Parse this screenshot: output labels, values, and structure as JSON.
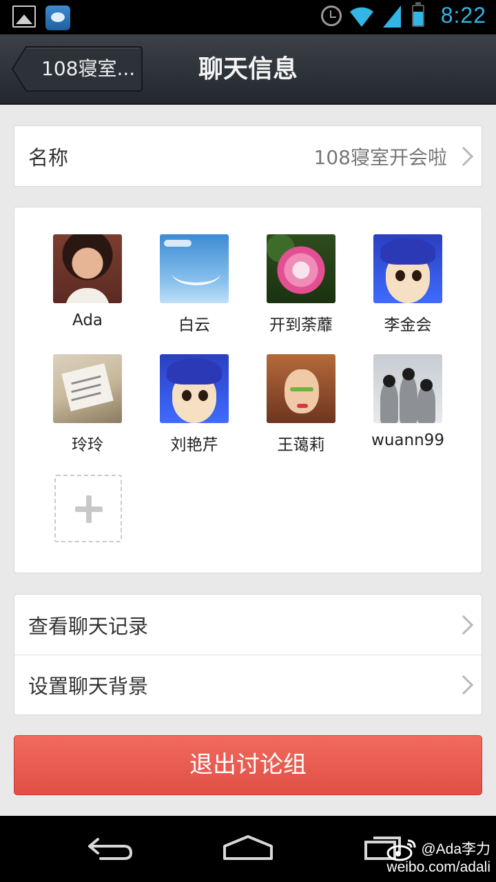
{
  "status_bar": {
    "time": "8:22",
    "accent_color": "#33b5e5"
  },
  "title_bar": {
    "back_label": "108寝室...",
    "title": "聊天信息"
  },
  "name_row": {
    "label": "名称",
    "value": "108寝室开会啦"
  },
  "members": [
    {
      "name": "Ada",
      "avatar": "photo-woman"
    },
    {
      "name": "白云",
      "avatar": "sky-cloud"
    },
    {
      "name": "开到荼蘼",
      "avatar": "pink-rose"
    },
    {
      "name": "李金会",
      "avatar": "anime-girl-blue-hair"
    },
    {
      "name": "玲玲",
      "avatar": "open-book"
    },
    {
      "name": "刘艳芹",
      "avatar": "anime-girl-blue-hair"
    },
    {
      "name": "王蔼莉",
      "avatar": "cartoon-woman-green-eyeshadow"
    },
    {
      "name": "wuann99",
      "avatar": "penguins"
    }
  ],
  "menu": {
    "history_label": "查看聊天记录",
    "background_label": "设置聊天背景"
  },
  "exit_button": {
    "label": "退出讨论组",
    "color": "#e85a4f"
  },
  "watermark": {
    "handle": "@Ada李力",
    "url": "weibo.com/adali"
  }
}
